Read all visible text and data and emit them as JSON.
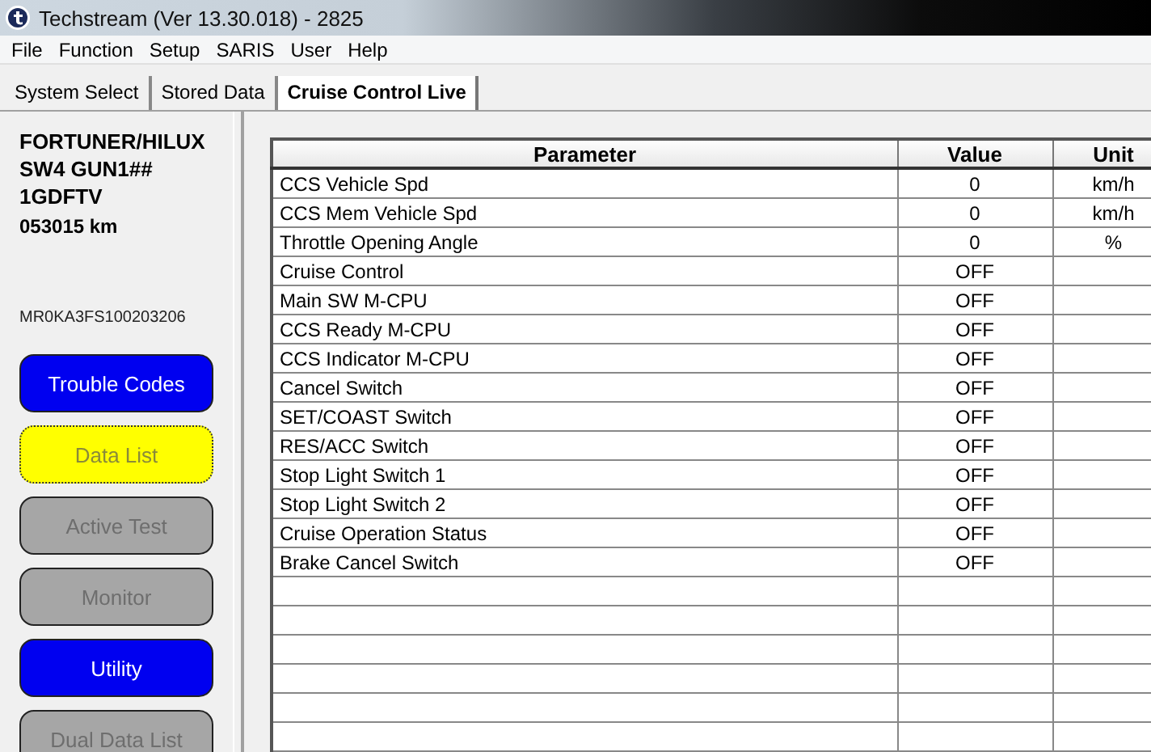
{
  "window": {
    "title": "Techstream (Ver 13.30.018) - 2825"
  },
  "menu": [
    "File",
    "Function",
    "Setup",
    "SARIS",
    "User",
    "Help"
  ],
  "tabs": [
    {
      "label": "System Select",
      "selected": false
    },
    {
      "label": "Stored Data",
      "selected": false
    },
    {
      "label": "Cruise Control Live",
      "selected": true
    }
  ],
  "vehicle": {
    "model": "FORTUNER/HILUX",
    "variant": "SW4 GUN1##",
    "engine": "1GDFTV",
    "odometer": "053015 km",
    "vin": "MR0KA3FS100203206"
  },
  "buttons": [
    {
      "label": "Trouble Codes",
      "kind": "enabled"
    },
    {
      "label": "Data List",
      "kind": "current"
    },
    {
      "label": "Active Test",
      "kind": "disabled"
    },
    {
      "label": "Monitor",
      "kind": "disabled"
    },
    {
      "label": "Utility",
      "kind": "enabled"
    },
    {
      "label": "Dual Data List",
      "kind": "disabled"
    }
  ],
  "table": {
    "columns": [
      "Parameter",
      "Value",
      "Unit"
    ],
    "rows": [
      [
        "CCS Vehicle Spd",
        "0",
        "km/h"
      ],
      [
        "CCS Mem Vehicle Spd",
        "0",
        "km/h"
      ],
      [
        "Throttle Opening Angle",
        "0",
        "%"
      ],
      [
        "Cruise Control",
        "OFF",
        ""
      ],
      [
        "Main SW M-CPU",
        "OFF",
        ""
      ],
      [
        "CCS Ready M-CPU",
        "OFF",
        ""
      ],
      [
        "CCS Indicator M-CPU",
        "OFF",
        ""
      ],
      [
        "Cancel Switch",
        "OFF",
        ""
      ],
      [
        "SET/COAST Switch",
        "OFF",
        ""
      ],
      [
        "RES/ACC Switch",
        "OFF",
        ""
      ],
      [
        "Stop Light Switch 1",
        "OFF",
        ""
      ],
      [
        "Stop Light Switch 2",
        "OFF",
        ""
      ],
      [
        "Cruise Operation Status",
        "OFF",
        ""
      ],
      [
        "Brake Cancel Switch",
        "OFF",
        ""
      ]
    ]
  }
}
